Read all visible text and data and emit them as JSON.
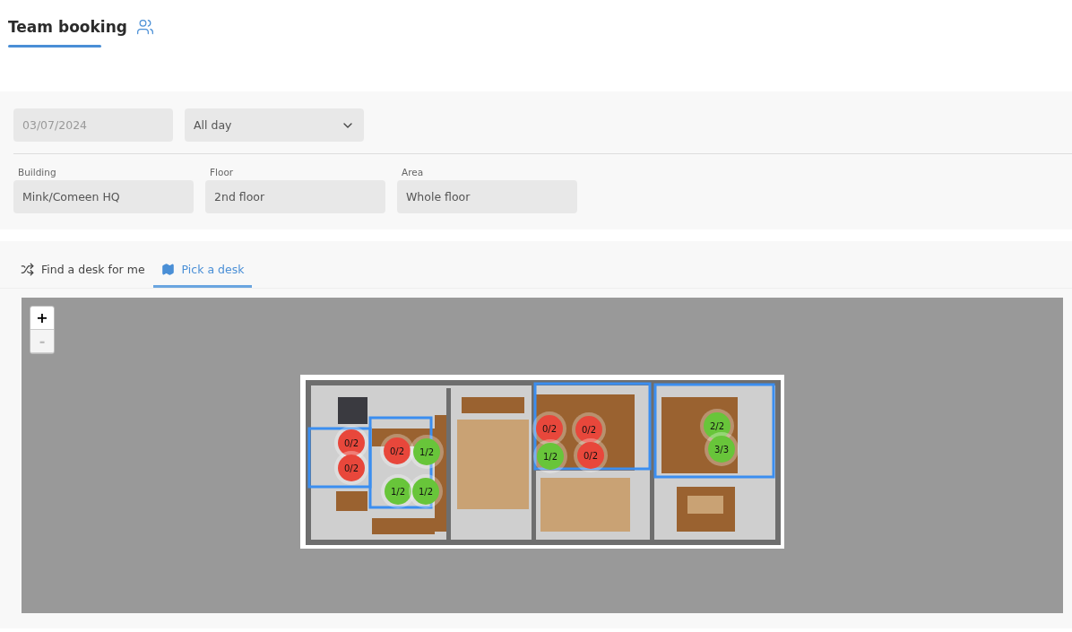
{
  "page": {
    "title": "Team booking"
  },
  "filters": {
    "date": {
      "placeholder": "03/07/2024"
    },
    "time": {
      "value": "All day"
    },
    "fields": [
      {
        "label": "Building",
        "value": "Mink/Comeen HQ"
      },
      {
        "label": "Floor",
        "value": "2nd floor"
      },
      {
        "label": "Area",
        "value": "Whole floor"
      }
    ]
  },
  "tabs": [
    {
      "label": "Find a desk for me",
      "kind": "shuffle",
      "selected": false
    },
    {
      "label": "Pick a desk",
      "kind": "map",
      "selected": true
    }
  ],
  "map": {
    "zoom_in": "+",
    "zoom_out": "-",
    "zoom_out_disabled": true,
    "desks": [
      {
        "occupancy": "0/2",
        "color": "#e8473b"
      },
      {
        "occupancy": "0/2",
        "color": "#e8473b"
      },
      {
        "occupancy": "0/2",
        "color": "#e8473b"
      },
      {
        "occupancy": "1/2",
        "color": "#68c53a"
      },
      {
        "occupancy": "1/2",
        "color": "#68c53a"
      },
      {
        "occupancy": "1/2",
        "color": "#68c53a"
      },
      {
        "occupancy": "0/2",
        "color": "#e8473b"
      },
      {
        "occupancy": "0/2",
        "color": "#e8473b"
      },
      {
        "occupancy": "1/2",
        "color": "#68c53a"
      },
      {
        "occupancy": "0/2",
        "color": "#e8473b"
      },
      {
        "occupancy": "2/2",
        "color": "#68c53a"
      },
      {
        "occupancy": "3/3",
        "color": "#68c53a"
      }
    ]
  }
}
